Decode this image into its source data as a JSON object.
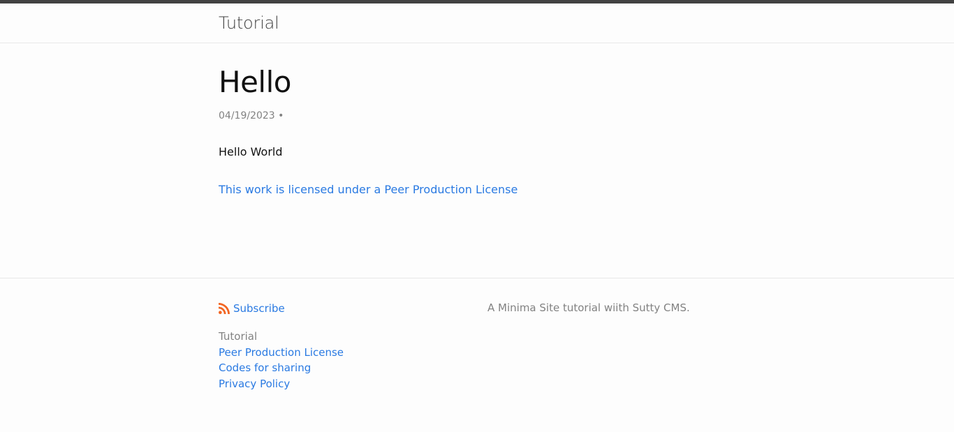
{
  "header": {
    "site_title": "Tutorial"
  },
  "post": {
    "title": "Hello",
    "meta": "04/19/2023 •",
    "body": "Hello World",
    "license_link": "This work is licensed under a Peer Production License"
  },
  "footer": {
    "subscribe_label": "Subscribe",
    "subscribe_icon": "rss-icon",
    "site_name": "Tutorial",
    "links": [
      "Peer Production License",
      "Codes for sharing",
      "Privacy Policy"
    ],
    "description": "A Minima Site tutorial wiith Sutty CMS."
  },
  "colors": {
    "topbar": "#424242",
    "link": "#2a7ae2",
    "muted": "#828282",
    "rss": "#f26522",
    "background": "#fdfdfd"
  }
}
